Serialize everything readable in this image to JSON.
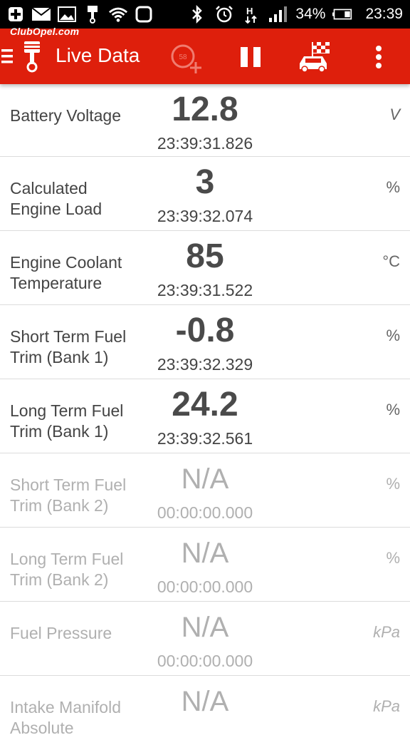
{
  "status_bar": {
    "battery_percent": "34%",
    "time": "23:39",
    "icons": [
      "plus-icon",
      "mail-icon",
      "image-icon",
      "piston-icon",
      "wifi-icon",
      "watch-icon",
      "bluetooth-icon",
      "alarm-icon",
      "h-signal-icon",
      "cell-signal-icon",
      "battery-icon"
    ]
  },
  "watermark": "ClubOpel.com",
  "toolbar": {
    "title": "Live Data",
    "speed_badge": "58",
    "accent": "#de1f0c"
  },
  "rows": [
    {
      "label": "Battery Voltage",
      "value": "12.8",
      "time": "23:39:31.826",
      "unit": "V"
    },
    {
      "label": "Calculated Engine Load",
      "value": "3",
      "time": "23:39:32.074",
      "unit": "%"
    },
    {
      "label": "Engine Coolant Temperature",
      "value": "85",
      "time": "23:39:31.522",
      "unit": "°C"
    },
    {
      "label": "Short Term Fuel Trim (Bank 1)",
      "value": "-0.8",
      "time": "23:39:32.329",
      "unit": "%"
    },
    {
      "label": "Long Term Fuel Trim (Bank 1)",
      "value": "24.2",
      "time": "23:39:32.561",
      "unit": "%"
    },
    {
      "label": "Short Term Fuel Trim (Bank 2)",
      "value": "N/A",
      "time": "00:00:00.000",
      "unit": "%"
    },
    {
      "label": "Long Term Fuel Trim (Bank 2)",
      "value": "N/A",
      "time": "00:00:00.000",
      "unit": "%"
    },
    {
      "label": "Fuel Pressure",
      "value": "N/A",
      "time": "00:00:00.000",
      "unit": "kPa"
    },
    {
      "label": "Intake Manifold Absolute",
      "value": "N/A",
      "time": "",
      "unit": "kPa"
    }
  ]
}
